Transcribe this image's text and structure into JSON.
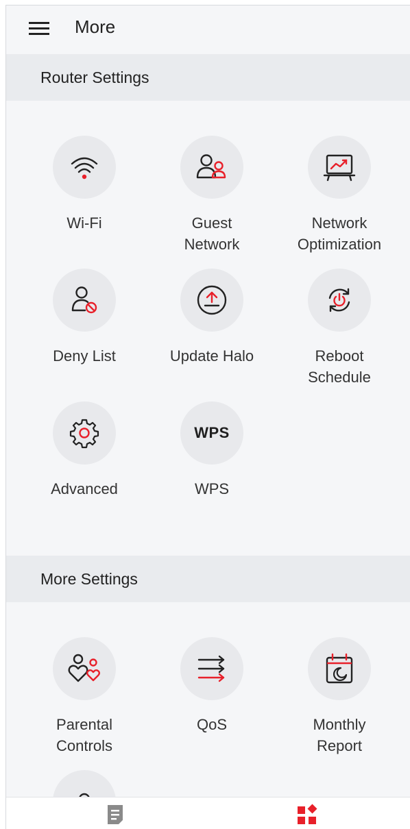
{
  "header": {
    "title": "More"
  },
  "sections": [
    {
      "title": "Router Settings"
    },
    {
      "title": "More Settings"
    }
  ],
  "router_items": [
    {
      "label": "Wi-Fi",
      "icon": "wifi-icon"
    },
    {
      "label": "Guest\nNetwork",
      "icon": "guest-network-icon"
    },
    {
      "label": "Network\nOptimization",
      "icon": "network-optimization-icon"
    },
    {
      "label": "Deny List",
      "icon": "deny-list-icon"
    },
    {
      "label": "Update Halo",
      "icon": "update-icon"
    },
    {
      "label": "Reboot\nSchedule",
      "icon": "reboot-schedule-icon"
    },
    {
      "label": "Advanced",
      "icon": "gear-icon"
    },
    {
      "label": "WPS",
      "icon": "wps-icon",
      "icon_text": "WPS"
    }
  ],
  "more_items": [
    {
      "label": "Parental\nControls",
      "icon": "parental-controls-icon"
    },
    {
      "label": "QoS",
      "icon": "qos-icon"
    },
    {
      "label": "Monthly\nReport",
      "icon": "monthly-report-icon"
    },
    {
      "label": "",
      "icon": "user-icon"
    }
  ],
  "bottom_nav": [
    {
      "name": "list-tab",
      "icon": "document-icon",
      "active": false
    },
    {
      "name": "more-tab",
      "icon": "apps-icon",
      "active": true
    }
  ],
  "colors": {
    "accent": "#e8202a",
    "icon": "#222222",
    "inactive_tab": "#8a8a8a"
  }
}
